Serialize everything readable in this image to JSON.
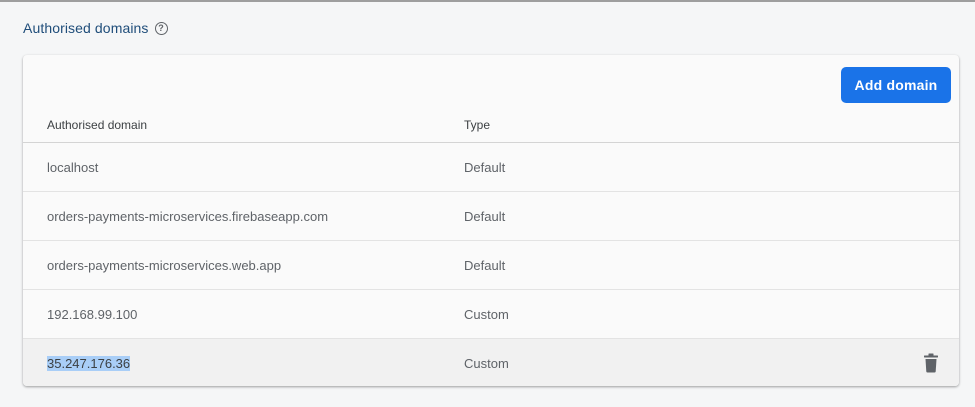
{
  "section": {
    "title": "Authorised domains",
    "help_icon": "question-circle-icon"
  },
  "toolbar": {
    "add_label": "Add domain"
  },
  "table": {
    "columns": [
      "Authorised domain",
      "Type"
    ],
    "rows": [
      {
        "domain": "localhost",
        "type": "Default"
      },
      {
        "domain": "orders-payments-microservices.firebaseapp.com",
        "type": "Default"
      },
      {
        "domain": "orders-payments-microservices.web.app",
        "type": "Default"
      },
      {
        "domain": "192.168.99.100",
        "type": "Custom"
      },
      {
        "domain": "35.247.176.36",
        "type": "Custom",
        "delete_icon": "trash-icon"
      }
    ]
  },
  "colors": {
    "accent": "#1a73e8",
    "title": "#1f4d7a",
    "selection": "#a9cef7"
  }
}
